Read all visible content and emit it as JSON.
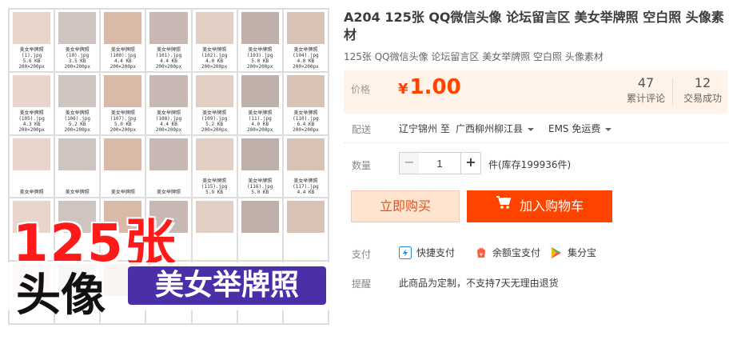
{
  "colors": {
    "accent": "#ff4400",
    "price_bg": "#fff2e8",
    "buy_now_bg": "#ffe4d0",
    "banner_red": "#ff1a1a",
    "banner_purple": "#4a2fa8"
  },
  "product_image": {
    "thumbnails": [
      {
        "name": "美女举牌照",
        "file": "(1).jpg",
        "size": "5.6 KB",
        "dim": "200×200px"
      },
      {
        "name": "美女举牌照",
        "file": "(10).jpg",
        "size": "3.5 KB",
        "dim": "200×200px"
      },
      {
        "name": "美女举牌照",
        "file": "(100).jpg",
        "size": "4.4 KB",
        "dim": "200×200px"
      },
      {
        "name": "美女举牌照",
        "file": "(101).jpg",
        "size": "4.4 KB",
        "dim": "200×200px"
      },
      {
        "name": "美女举牌照",
        "file": "(102).jpg",
        "size": "4.0 KB",
        "dim": "200×200px"
      },
      {
        "name": "美女举牌照",
        "file": "(103).jpg",
        "size": "5.0 KB",
        "dim": "200×200px"
      },
      {
        "name": "美女举牌照",
        "file": "(104).jpg",
        "size": "4.0 KB",
        "dim": "200×200px"
      },
      {
        "name": "美女举牌照",
        "file": "(105).jpg",
        "size": "4.3 KB",
        "dim": "200×200px"
      },
      {
        "name": "美女举牌照",
        "file": "(106).jpg",
        "size": "5.2 KB",
        "dim": "200×200px"
      },
      {
        "name": "美女举牌照",
        "file": "(107).jpg",
        "size": "5.0 KB",
        "dim": "200×200px"
      },
      {
        "name": "美女举牌照",
        "file": "(108).jpg",
        "size": "4.4 KB",
        "dim": "200×200px"
      },
      {
        "name": "美女举牌照",
        "file": "(109).jpg",
        "size": "5.2 KB",
        "dim": "200×200px"
      },
      {
        "name": "美女举牌照",
        "file": "(11).jpg",
        "size": "4.0 KB",
        "dim": "200×200px"
      },
      {
        "name": "美女举牌照",
        "file": "(110).jpg",
        "size": "6.4 KB",
        "dim": "200×200px"
      },
      {
        "name": "美女举牌照",
        "file": "",
        "size": "",
        "dim": ""
      },
      {
        "name": "美女举牌照",
        "file": "",
        "size": "",
        "dim": ""
      },
      {
        "name": "美女举牌照",
        "file": "",
        "size": "",
        "dim": ""
      },
      {
        "name": "美女举牌照",
        "file": "",
        "size": "",
        "dim": ""
      },
      {
        "name": "美女举牌照",
        "file": "(115).jpg",
        "size": "5.9 KB",
        "dim": ""
      },
      {
        "name": "美女举牌照",
        "file": "(116).jpg",
        "size": "5.0 KB",
        "dim": ""
      },
      {
        "name": "美女举牌照",
        "file": "(117).jpg",
        "size": "4.4 KB",
        "dim": ""
      }
    ],
    "banner_count": "125张",
    "banner_head": "头像",
    "banner_tag": "美女举牌照"
  },
  "product": {
    "title": "A204 125张 QQ微信头像 论坛留言区 美女举牌照 空白照 头像素材",
    "subtitle": "125张 QQ微信头像 论坛留言区 美女举牌照 空白照 头像素材"
  },
  "price": {
    "label": "价格",
    "currency": "¥",
    "value": "1.00"
  },
  "stats": {
    "reviews_count": "47",
    "reviews_label": "累计评论",
    "sales_count": "12",
    "sales_label": "交易成功"
  },
  "shipping": {
    "label": "配送",
    "from": "辽宁锦州 至",
    "to": "广西柳州柳江县",
    "method": "EMS 免运费"
  },
  "quantity": {
    "label": "数量",
    "minus": "−",
    "value": "1",
    "plus": "+",
    "stock": "件(库存199936件)"
  },
  "actions": {
    "buy_now": "立即购买",
    "add_cart": "加入购物车"
  },
  "payment": {
    "label": "支付",
    "options": [
      {
        "label": "快捷支付",
        "icon": "quick-pay-icon"
      },
      {
        "label": "余额宝支付",
        "icon": "yuebao-icon"
      },
      {
        "label": "集分宝",
        "icon": "jifenbao-icon"
      }
    ]
  },
  "reminder": {
    "label": "提醒",
    "text": "此商品为定制，不支持7天无理由退货"
  }
}
